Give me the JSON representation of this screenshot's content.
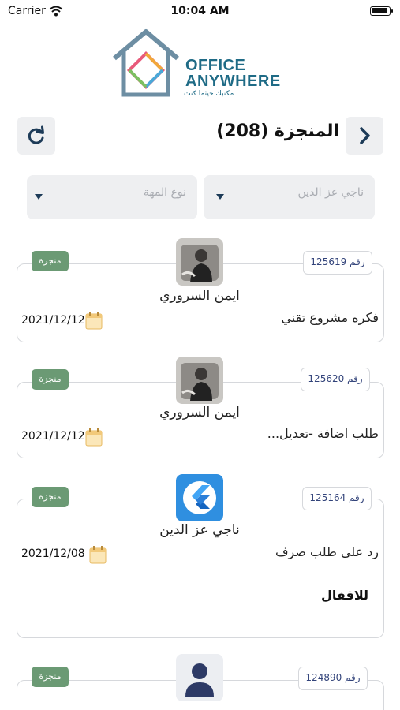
{
  "status_bar": {
    "carrier": "Carrier",
    "time": "10:04 AM"
  },
  "logo": {
    "line1": "OFFICE",
    "line2": "ANYWHERE",
    "tagline": "مكتبك حيثما كنت"
  },
  "header": {
    "title": "المنجزة (208)"
  },
  "filters": {
    "user_placeholder": "ناجي عز الدين",
    "task_type_placeholder": "نوع المهة"
  },
  "tasks": [
    {
      "number": "رقم 125619",
      "status": "منجزة",
      "owner": "ايمن السروري",
      "date": "2021/12/12",
      "title": "فكره مشروع تقني"
    },
    {
      "number": "رقم 125620",
      "status": "منجزة",
      "owner": "ايمن السروري",
      "date": "2021/12/12",
      "title": "طلب اضافة -تعديل..."
    },
    {
      "number": "رقم 125164",
      "status": "منجزة",
      "owner": "ناجي عز الدين",
      "date": "2021/12/08",
      "title": "رد على طلب صرف",
      "note": "للاقفال"
    },
    {
      "number": "رقم 124890",
      "status": "منجزة"
    }
  ],
  "colors": {
    "accent": "#1d3b58",
    "done_badge": "#6b9a74",
    "logo_blue": "#1f6b86"
  },
  "icons": [
    "wifi-icon",
    "battery-icon",
    "refresh-icon",
    "chevron-right-icon",
    "caret-down-icon",
    "calendar-icon"
  ]
}
